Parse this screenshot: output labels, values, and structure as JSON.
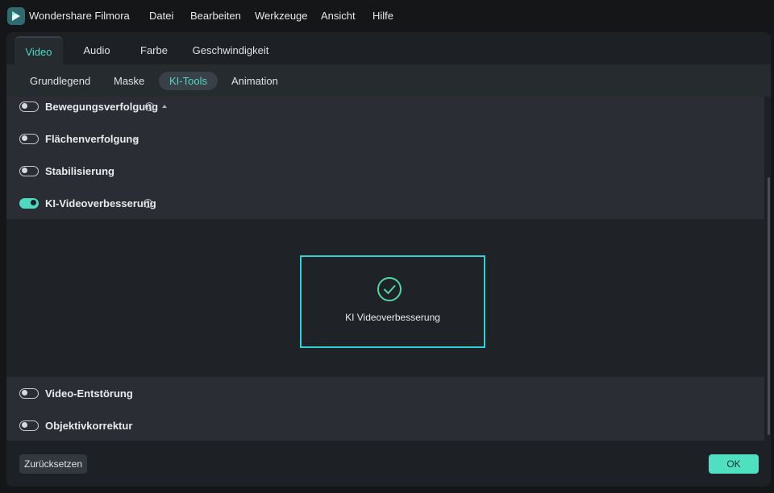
{
  "app": {
    "title": "Wondershare Filmora",
    "menu": [
      "Datei",
      "Bearbeiten",
      "Werkzeuge",
      "Ansicht",
      "Hilfe"
    ]
  },
  "tabs": [
    "Video",
    "Audio",
    "Farbe",
    "Geschwindigkeit"
  ],
  "subtabs": [
    "Grundlegend",
    "Maske",
    "KI-Tools",
    "Animation"
  ],
  "rows": [
    {
      "label": "Bewegungsverfolgung",
      "on": false
    },
    {
      "label": "Flächenverfolgung",
      "on": false
    },
    {
      "label": "Stabilisierung",
      "on": false
    },
    {
      "label": "KI-Videoverbesserung",
      "on": true
    },
    {
      "label": "Video-Entstörung",
      "on": false
    },
    {
      "label": "Objektivkorrektur",
      "on": false
    }
  ],
  "preview": {
    "label": "KI Videoverbesserung"
  },
  "footer": {
    "reset_label": "Zurücksetzen",
    "ok_label": "OK"
  },
  "colors": {
    "accent": "#4fd9c0",
    "preview_border": "#2fd3d6",
    "background": "#1d2024"
  }
}
